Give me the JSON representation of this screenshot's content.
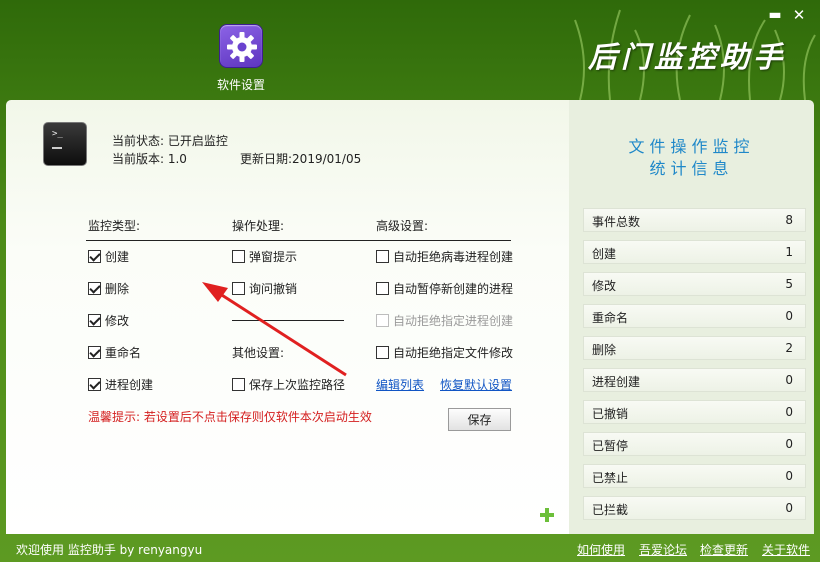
{
  "app": {
    "brand": "后门监控助手",
    "window_minimize": "▬",
    "window_close": "✕"
  },
  "toolbar": {
    "settings_label": "软件设置",
    "settings_icon": "gear-icon"
  },
  "status": {
    "state": "当前状态: 已开启监控",
    "version": "当前版本: 1.0",
    "update_date": "更新日期:2019/01/05"
  },
  "columns": {
    "monitor_type": "监控类型:",
    "operation": "操作处理:",
    "advanced": "高级设置:",
    "other": "其他设置:"
  },
  "monitor_types": [
    {
      "label": "创建",
      "checked": true
    },
    {
      "label": "删除",
      "checked": true
    },
    {
      "label": "修改",
      "checked": true
    },
    {
      "label": "重命名",
      "checked": true
    },
    {
      "label": "进程创建",
      "checked": true
    }
  ],
  "operations": [
    {
      "label": "弹窗提示",
      "checked": false
    },
    {
      "label": "询问撤销",
      "checked": false
    }
  ],
  "other_settings": [
    {
      "label": "保存上次监控路径",
      "checked": false
    }
  ],
  "advanced_settings": [
    {
      "label": "自动拒绝病毒进程创建",
      "checked": false,
      "disabled": false
    },
    {
      "label": "自动暂停新创建的进程",
      "checked": false,
      "disabled": false
    },
    {
      "label": "自动拒绝指定进程创建",
      "checked": false,
      "disabled": true
    },
    {
      "label": "自动拒绝指定文件修改",
      "checked": false,
      "disabled": false
    }
  ],
  "links": {
    "edit_list": "编辑列表",
    "restore_default": "恢复默认设置"
  },
  "warning": "温馨提示: 若设置后不点击保存则仅软件本次启动生效",
  "save_label": "保存",
  "stats": {
    "title_line1": "文件操作监控",
    "title_line2": "统计信息",
    "rows": [
      {
        "label": "事件总数",
        "value": "8"
      },
      {
        "label": "创建",
        "value": "1"
      },
      {
        "label": "修改",
        "value": "5"
      },
      {
        "label": "重命名",
        "value": "0"
      },
      {
        "label": "删除",
        "value": "2"
      },
      {
        "label": "进程创建",
        "value": "0"
      },
      {
        "label": "已撤销",
        "value": "0"
      },
      {
        "label": "已暂停",
        "value": "0"
      },
      {
        "label": "已禁止",
        "value": "0"
      },
      {
        "label": "已拦截",
        "value": "0"
      }
    ]
  },
  "footer": {
    "welcome": "欢迎使用 监控助手  by  renyangyu",
    "links": [
      "如何使用",
      "吾爱论坛",
      "检查更新",
      "关于软件"
    ]
  },
  "colors": {
    "header_green": "#2f6a0a",
    "accent_blue": "#1f88c9",
    "warning_red": "#d42020",
    "link_blue": "#1155c4",
    "gear_purple": "#6a42cf",
    "arrow_red": "#e02020"
  }
}
